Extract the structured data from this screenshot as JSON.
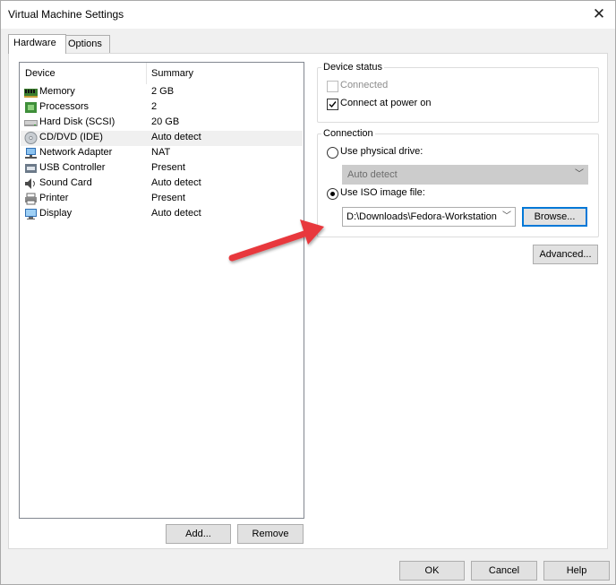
{
  "window": {
    "title": "Virtual Machine Settings"
  },
  "tabs": [
    {
      "label": "Hardware"
    },
    {
      "label": "Options"
    }
  ],
  "device_list": {
    "headers": {
      "device": "Device",
      "summary": "Summary"
    },
    "rows": [
      {
        "device": "Memory",
        "summary": "2 GB",
        "icon": "memory-icon"
      },
      {
        "device": "Processors",
        "summary": "2",
        "icon": "processor-icon"
      },
      {
        "device": "Hard Disk (SCSI)",
        "summary": "20 GB",
        "icon": "hard-disk-icon"
      },
      {
        "device": "CD/DVD (IDE)",
        "summary": "Auto detect",
        "icon": "cd-dvd-icon"
      },
      {
        "device": "Network Adapter",
        "summary": "NAT",
        "icon": "network-adapter-icon"
      },
      {
        "device": "USB Controller",
        "summary": "Present",
        "icon": "usb-icon"
      },
      {
        "device": "Sound Card",
        "summary": "Auto detect",
        "icon": "sound-card-icon"
      },
      {
        "device": "Printer",
        "summary": "Present",
        "icon": "printer-icon"
      },
      {
        "device": "Display",
        "summary": "Auto detect",
        "icon": "display-icon"
      }
    ],
    "selected_row": "CD/DVD (IDE)"
  },
  "list_buttons": {
    "add": "Add...",
    "remove": "Remove"
  },
  "device_status": {
    "title": "Device status",
    "connected": {
      "label": "Connected",
      "checked": false,
      "enabled": false
    },
    "connect_power_on": {
      "label": "Connect at power on",
      "checked": true
    }
  },
  "connection": {
    "title": "Connection",
    "physical_drive": {
      "label": "Use physical drive:",
      "selected": false,
      "value": "Auto detect"
    },
    "iso": {
      "label": "Use ISO image file:",
      "selected": true,
      "value": "D:\\Downloads\\Fedora-Workstation"
    },
    "browse": "Browse..."
  },
  "advanced": "Advanced...",
  "footer": {
    "ok": "OK",
    "cancel": "Cancel",
    "help": "Help"
  },
  "colors": {
    "arrow": "#e8383d",
    "focus": "#0078d7"
  }
}
